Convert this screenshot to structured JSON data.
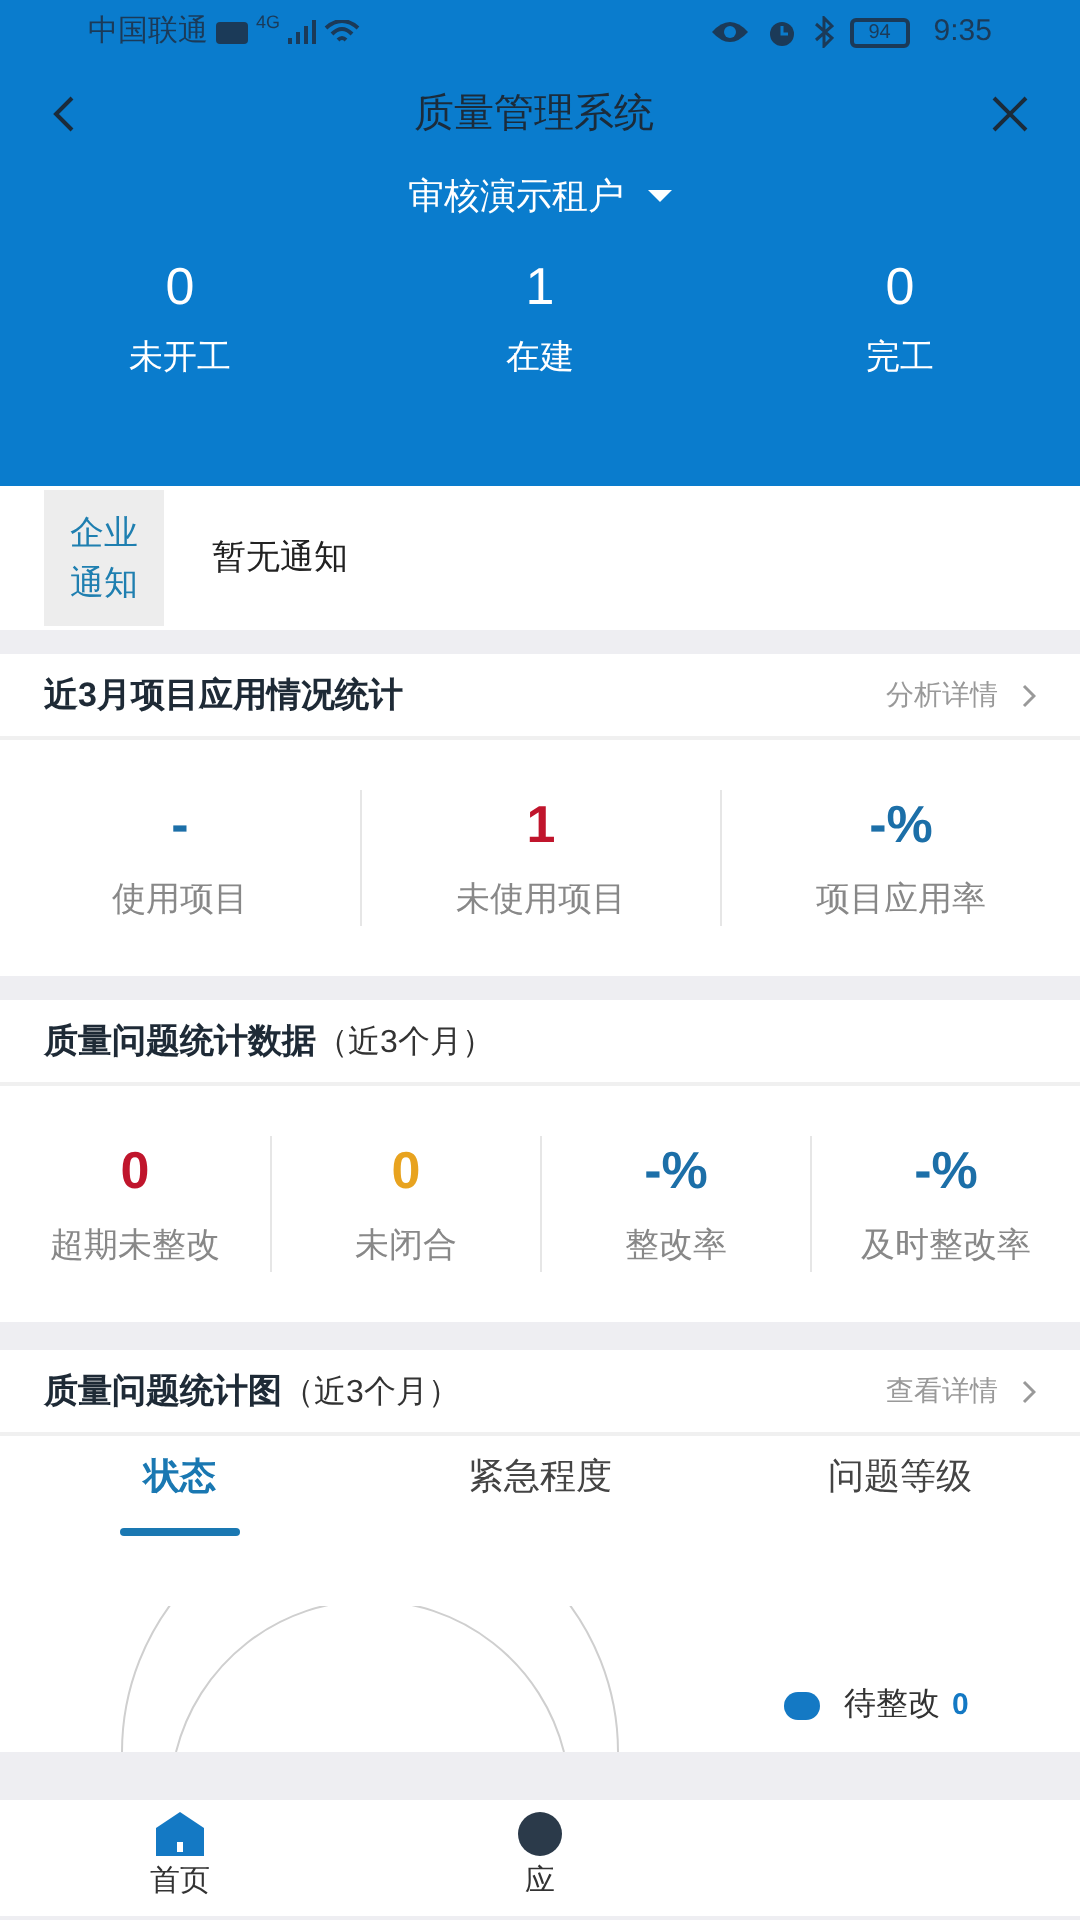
{
  "status_bar": {
    "carrier": "中国联通",
    "network": "4G",
    "battery": "94",
    "time": "9:35"
  },
  "header": {
    "title": "质量管理系统",
    "tenant": "审核演示租户",
    "stats": [
      {
        "value": "0",
        "label": "未开工"
      },
      {
        "value": "1",
        "label": "在建"
      },
      {
        "value": "0",
        "label": "完工"
      }
    ]
  },
  "notice": {
    "tag": "企业通知",
    "text": "暂无通知"
  },
  "project_stats": {
    "title": "近3月项目应用情况统计",
    "link": "分析详情",
    "items": [
      {
        "value": "-",
        "label": "使用项目",
        "color": "#1c6fa8"
      },
      {
        "value": "1",
        "label": "未使用项目",
        "color": "#c0152c"
      },
      {
        "value": "-%",
        "label": "项目应用率",
        "color": "#1c6fa8"
      }
    ]
  },
  "issue_stats": {
    "title": "质量问题统计数据",
    "subtitle": "（近3个月）",
    "items": [
      {
        "value": "0",
        "label": "超期未整改",
        "color": "#c0152c"
      },
      {
        "value": "0",
        "label": "未闭合",
        "color": "#e8a31f"
      },
      {
        "value": "-%",
        "label": "整改率",
        "color": "#1c6fa8"
      },
      {
        "value": "-%",
        "label": "及时整改率",
        "color": "#1c6fa8"
      }
    ]
  },
  "issue_chart": {
    "title": "质量问题统计图",
    "subtitle": "（近3个月）",
    "link": "查看详情",
    "tabs": [
      {
        "label": "状态",
        "selected": true
      },
      {
        "label": "紧急程度",
        "selected": false
      },
      {
        "label": "问题等级",
        "selected": false
      }
    ],
    "legend": [
      {
        "label": "待整改",
        "count": "0",
        "color": "#1479c4"
      }
    ]
  },
  "bottom_nav": [
    {
      "label": "首页",
      "selected": true,
      "kind": "home"
    },
    {
      "label": "应",
      "selected": false,
      "kind": "app"
    }
  ]
}
